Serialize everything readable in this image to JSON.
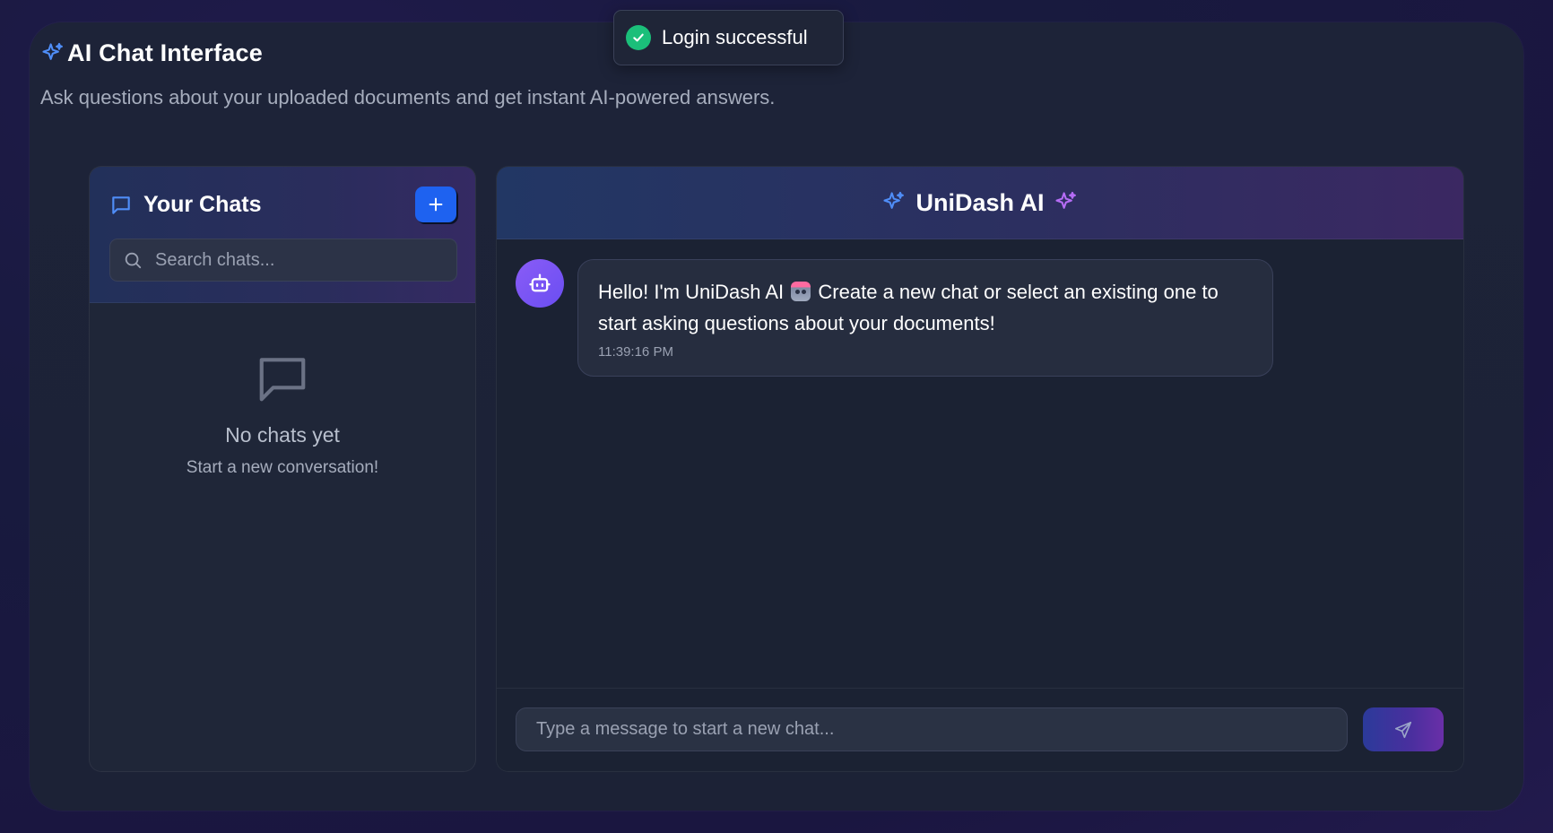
{
  "page": {
    "title": "AI Chat Interface",
    "subtitle": "Ask questions about your uploaded documents and get instant AI-powered answers."
  },
  "toast": {
    "message": "Login successful",
    "icon": "check-circle-icon",
    "color": "#1bbf7a"
  },
  "sidebar": {
    "title": "Your Chats",
    "new_chat_icon": "plus-icon",
    "search_placeholder": "Search chats...",
    "empty_title": "No chats yet",
    "empty_subtitle": "Start a new conversation!"
  },
  "chat": {
    "title": "UniDash AI",
    "messages": [
      {
        "sender": "bot",
        "text_before": "Hello! I'm UniDash AI",
        "emoji": "robot-emoji",
        "text_after": "Create a new chat or select an existing one to start asking questions about your documents!",
        "time": "11:39:16 PM"
      }
    ],
    "input_placeholder": "Type a message to start a new chat...",
    "send_icon": "send-icon"
  },
  "colors": {
    "accent_blue": "#1e62f0",
    "accent_purple": "#8a5cf6",
    "sparkle_blue": "#4f8df7",
    "sparkle_purple": "#b56cf5"
  }
}
